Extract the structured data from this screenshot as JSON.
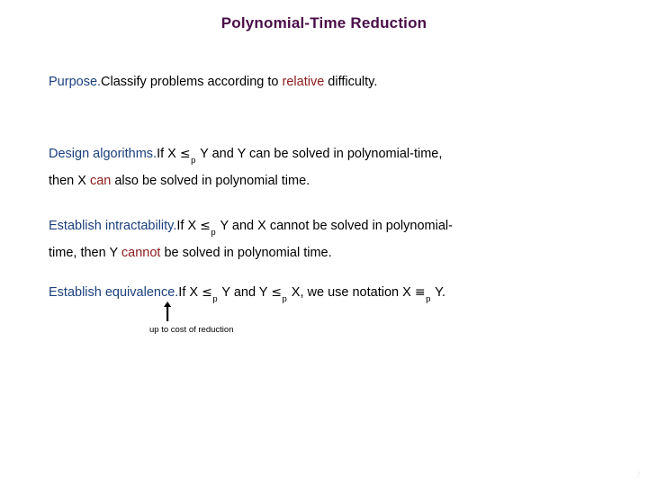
{
  "slide": {
    "title": "Polynomial-Time Reduction",
    "page_number": "7",
    "colors": {
      "title": "#4a0d49",
      "heading": "#1b3f7d",
      "emphasis": "#8d1a1c",
      "body": "#000000",
      "background": "#ffffff"
    },
    "blocks": [
      {
        "heading": "Purpose.",
        "text_before": "Classify problems according to ",
        "emphasis": "relative",
        "text_after": " difficulty."
      },
      {
        "heading": "Design algorithms.",
        "line1_a": "If X ",
        "line1_op": "≤",
        "line1_sub": "p",
        "line1_b": " Y and Y can be solved in polynomial-time,",
        "line2_a": "then X ",
        "line2_emphasis": "can",
        "line2_b": " also be solved in polynomial time."
      },
      {
        "heading": "Establish intractability.",
        "line1_a": "If X ",
        "line1_op": "≤",
        "line1_sub": "p",
        "line1_b": " Y and X cannot be solved in polynomial-",
        "line2_a": "time, then Y ",
        "line2_emphasis": "cannot",
        "line2_b": " be solved in polynomial time."
      },
      {
        "heading": "Establish equivalence.",
        "line1_a": "If X ",
        "op1": "≤",
        "sub1": "p",
        "line1_b": " Y and Y ",
        "op2": "≤",
        "sub2": "p",
        "line1_c": " X, we use notation X ",
        "op3": "≡",
        "sub3": "p",
        "line1_d": " Y."
      }
    ],
    "annotation": {
      "caption": "up to cost of reduction",
      "arrow_icon": "arrow-up-icon"
    }
  }
}
